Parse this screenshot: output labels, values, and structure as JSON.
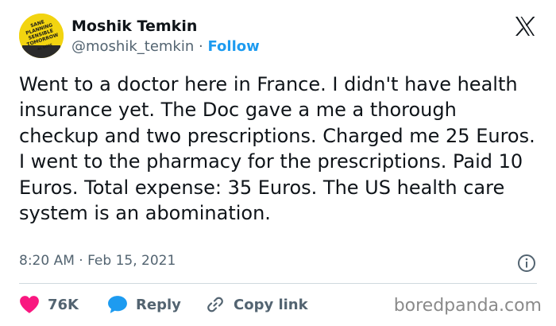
{
  "author": {
    "name": "Moshik Temkin",
    "handle": "@moshik_temkin",
    "separator": "·",
    "follow_label": "Follow",
    "avatar_text": [
      "SANE",
      "PLANNING",
      "SENSIBLE",
      "TOMORROW",
      "AL GORE"
    ]
  },
  "tweet": {
    "text": "Went to a doctor here in France. I didn't have health insurance yet. The Doc gave a me a thorough checkup and two prescriptions. Charged me 25 Euros. I went to the pharmacy for the prescriptions. Paid 10 Euros. Total expense: 35 Euros. The US health care system is an abomination.",
    "timestamp": "8:20 AM · Feb 15, 2021"
  },
  "actions": {
    "likes_count": "76K",
    "reply_label": "Reply",
    "copy_link_label": "Copy link"
  },
  "watermark": "boredpanda.com",
  "icons": {
    "logo": "x-logo-icon",
    "info": "info-icon",
    "like": "heart-icon",
    "reply": "speech-bubble-icon",
    "copy": "link-icon"
  },
  "colors": {
    "accent": "#1d9bf0",
    "like": "#f91880",
    "text": "#0f1419",
    "muted": "#536471",
    "avatar_bg": "#f2d410"
  }
}
